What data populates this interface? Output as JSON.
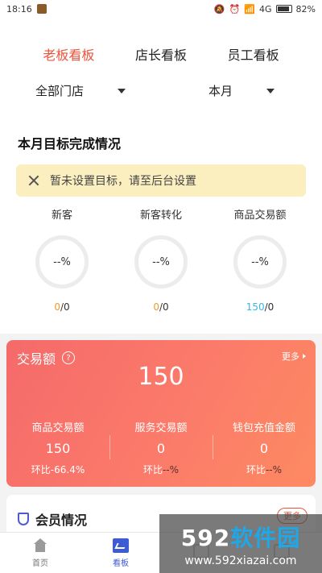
{
  "status_bar": {
    "time": "18:16",
    "network": "4G",
    "battery": "82%",
    "battery_level": 0.82
  },
  "tabs": [
    "老板看板",
    "店长看板",
    "员工看板"
  ],
  "filters": [
    "全部门店",
    "本月"
  ],
  "goal": {
    "title": "本月目标完成情况",
    "notice": "暂未设置目标，请至后台设置",
    "metrics": [
      {
        "label": "新客",
        "ring": "--%",
        "done": "0",
        "total": "/0"
      },
      {
        "label": "新客转化",
        "ring": "--%",
        "done": "0",
        "total": "/0"
      },
      {
        "label": "商品交易额",
        "ring": "--%",
        "done": "150",
        "total": "/0"
      }
    ]
  },
  "transaction": {
    "title": "交易额",
    "help": "?",
    "more": "更多",
    "amount": "150",
    "columns": [
      {
        "label": "商品交易额",
        "value": "150",
        "change_prefix": "环比",
        "change": "-66.4%"
      },
      {
        "label": "服务交易额",
        "value": "0",
        "change_prefix": "环比",
        "change": "--%"
      },
      {
        "label": "钱包充值金额",
        "value": "0",
        "change_prefix": "环比",
        "change": "--%"
      }
    ]
  },
  "member": {
    "title": "会员情况",
    "more": "更多"
  },
  "bottom_nav": [
    "首页",
    "看板",
    "",
    ""
  ],
  "watermark": {
    "num": "592",
    "cn": "软件园",
    "url": "www.592xiazai.com"
  }
}
